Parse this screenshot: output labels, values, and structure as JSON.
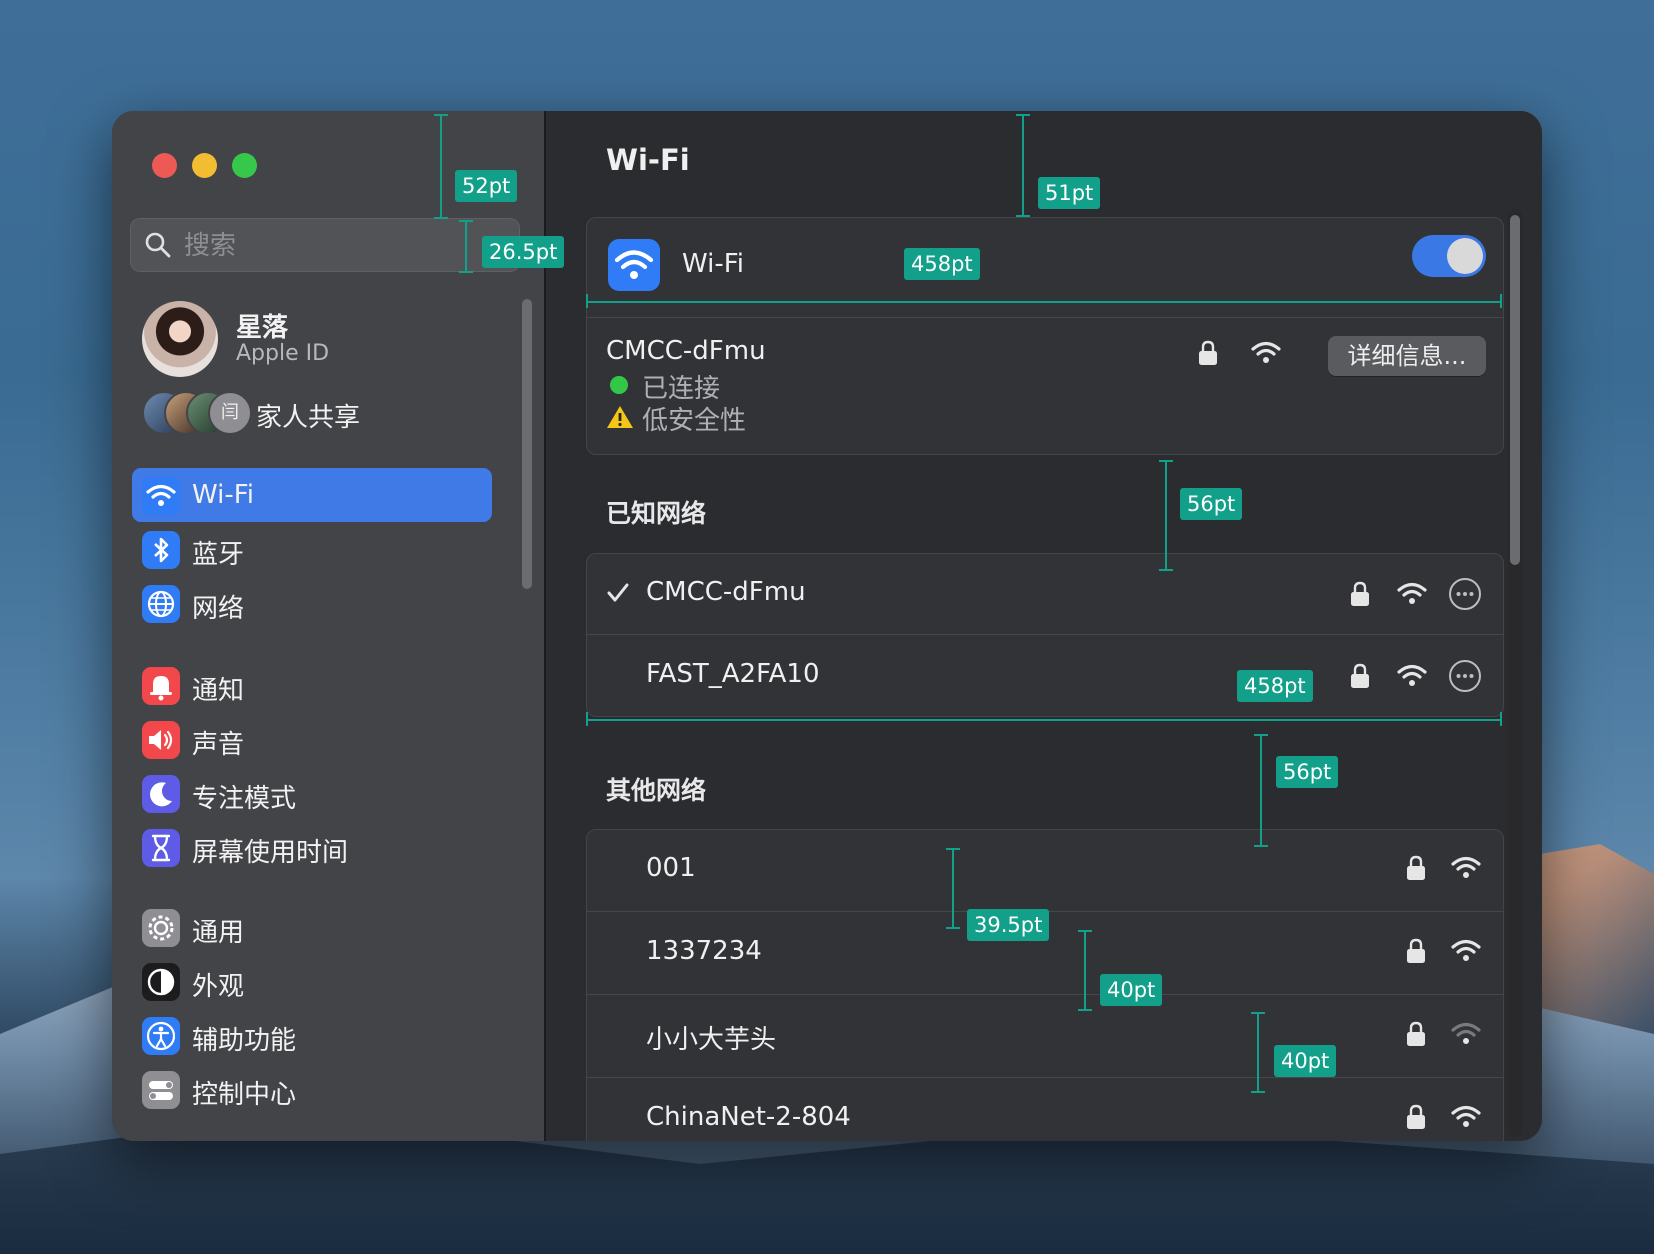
{
  "sidebar": {
    "search_placeholder": "搜索",
    "user": {
      "name": "星落",
      "subtitle": "Apple ID"
    },
    "family_label": "家人共享",
    "family_badge": "闫",
    "items": [
      {
        "label": "Wi-Fi",
        "icon": "wifi-icon",
        "color": "#2f7cf6",
        "selected": true
      },
      {
        "label": "蓝牙",
        "icon": "bluetooth-icon",
        "color": "#2f7cf6"
      },
      {
        "label": "网络",
        "icon": "globe-icon",
        "color": "#2f7cf6"
      },
      {
        "label": "通知",
        "icon": "bell-icon",
        "color": "#f2484b"
      },
      {
        "label": "声音",
        "icon": "speaker-icon",
        "color": "#f2484b"
      },
      {
        "label": "专注模式",
        "icon": "moon-icon",
        "color": "#5e5ce6"
      },
      {
        "label": "屏幕使用时间",
        "icon": "hourglass-icon",
        "color": "#5e5ce6"
      },
      {
        "label": "通用",
        "icon": "gear-icon",
        "color": "#8e8e93"
      },
      {
        "label": "外观",
        "icon": "appearance-icon",
        "color": "#1c1c1e"
      },
      {
        "label": "辅助功能",
        "icon": "accessibility-icon",
        "color": "#2f7cf6"
      },
      {
        "label": "控制中心",
        "icon": "control-center-icon",
        "color": "#8e8e93"
      }
    ]
  },
  "main": {
    "title": "Wi-Fi",
    "wifi_toggle": {
      "label": "Wi-Fi",
      "on": true
    },
    "current": {
      "name": "CMCC-dFmu",
      "status": "已连接",
      "warning": "低安全性",
      "details_button": "详细信息..."
    },
    "known_title": "已知网络",
    "known": [
      {
        "name": "CMCC-dFmu",
        "checked": true
      },
      {
        "name": "FAST_A2FA10",
        "checked": false
      }
    ],
    "other_title": "其他网络",
    "other": [
      {
        "name": "001",
        "signal": 3
      },
      {
        "name": "1337234",
        "signal": 3
      },
      {
        "name": "小小大芋头",
        "signal": 1
      },
      {
        "name": "ChinaNet-2-804",
        "signal": 3
      }
    ]
  },
  "annotations": {
    "a1": "52pt",
    "a2": "26.5pt",
    "a3": "51pt",
    "a4": "458pt",
    "a5": "56pt",
    "a6": "458pt",
    "a7": "56pt",
    "a8": "39.5pt",
    "a9": "40pt",
    "a10": "40pt"
  },
  "colors": {
    "accent": "#3f7ae6",
    "annotation": "#13a08a",
    "connected": "#33c748"
  }
}
